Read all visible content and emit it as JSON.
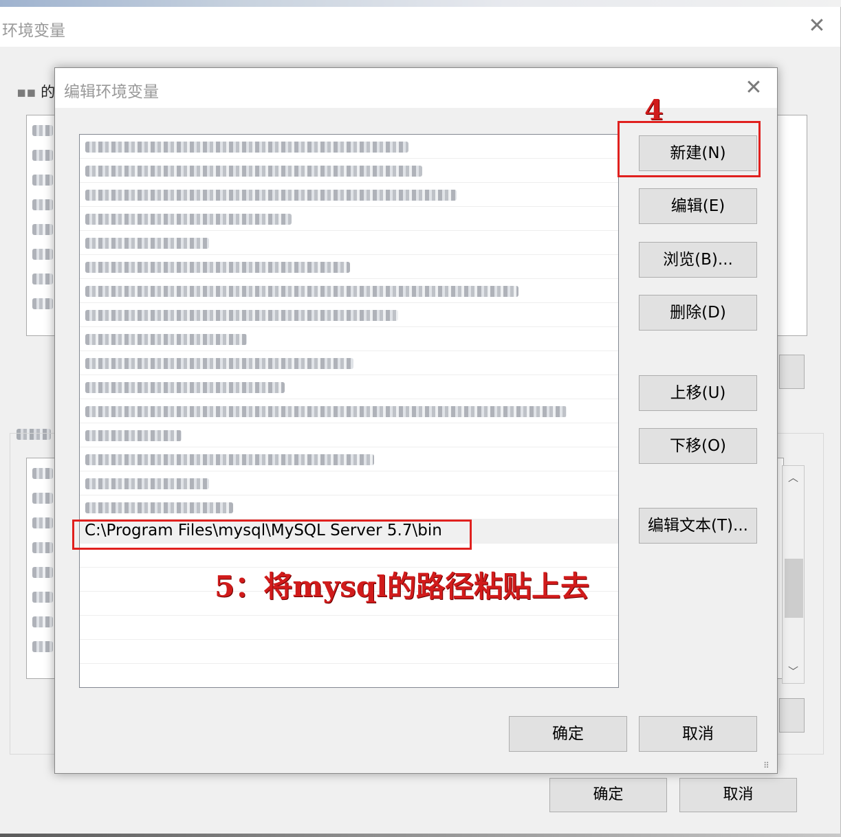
{
  "outer_window": {
    "title": "环境变量",
    "user_section_label": "的",
    "ok_button": "确定",
    "cancel_button": "取消"
  },
  "dialog": {
    "title": "编辑环境变量",
    "path_entries": [
      {
        "text": "",
        "obscured": true
      },
      {
        "text": "",
        "obscured": true
      },
      {
        "text": "",
        "obscured": true
      },
      {
        "text": "",
        "obscured": true
      },
      {
        "text": "",
        "obscured": true
      },
      {
        "text": "",
        "obscured": true
      },
      {
        "text": "",
        "obscured": true
      },
      {
        "text": "",
        "obscured": true
      },
      {
        "text": "",
        "obscured": true
      },
      {
        "text": "",
        "obscured": true
      },
      {
        "text": "",
        "obscured": true
      },
      {
        "text": "",
        "obscured": true
      },
      {
        "text": "",
        "obscured": true
      },
      {
        "text": "",
        "obscured": true
      },
      {
        "text": "",
        "obscured": true
      },
      {
        "text": "",
        "obscured": true
      },
      {
        "text": "C:\\Program Files\\mysql\\MySQL Server 5.7\\bin",
        "obscured": false,
        "selected": true
      }
    ],
    "buttons": {
      "new": "新建(N)",
      "edit": "编辑(E)",
      "browse": "浏览(B)...",
      "delete": "删除(D)",
      "move_up": "上移(U)",
      "move_down": "下移(O)",
      "edit_text": "编辑文本(T)...",
      "ok": "确定",
      "cancel": "取消"
    }
  },
  "annotations": {
    "step4": "4",
    "step5": "5：将mysql的路径粘贴上去",
    "color": "#e0201e"
  },
  "icons": {
    "close": "close-icon",
    "scroll_up": "chevron-up-icon",
    "scroll_down": "chevron-down-icon",
    "resize": "resize-grip-icon"
  }
}
